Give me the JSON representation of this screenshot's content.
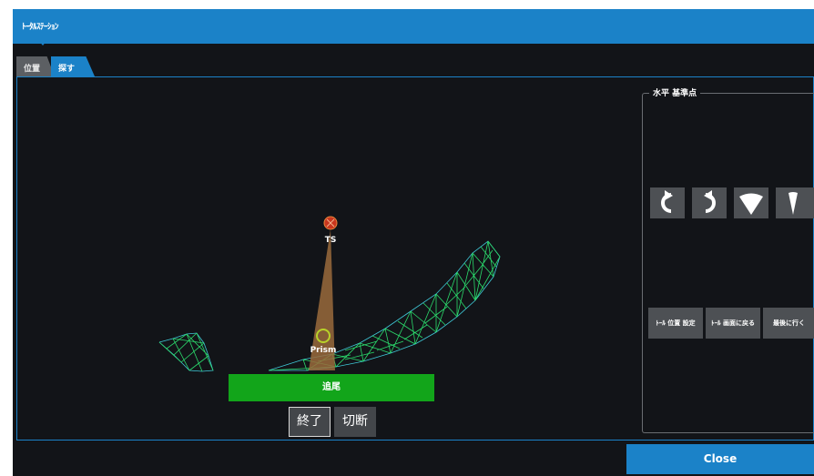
{
  "window": {
    "title": "ﾄｰﾀﾙｽﾃｰｼｮﾝ"
  },
  "tabs": [
    {
      "label": "位置",
      "active": false
    },
    {
      "label": "探す",
      "active": true
    }
  ],
  "scene": {
    "instrument_label": "TS",
    "target_label": "Prism"
  },
  "controls": {
    "track_label": "追尾",
    "end_label": "終了",
    "cut_label": "切断"
  },
  "reference": {
    "legend": "水平 基準点",
    "icons": [
      "rotate-left-icon",
      "rotate-right-icon",
      "fan-wide-icon",
      "fan-narrow-icon"
    ],
    "actions": [
      "ﾄｰﾙ 位置 設定",
      "ﾄｰﾙ 画面に戻る",
      "最後に行く"
    ]
  },
  "footer": {
    "close_label": "Close"
  },
  "colors": {
    "accent": "#1b82c8",
    "track_green": "#12a51a",
    "mesh_green": "#2bdb6c",
    "mesh_cyan": "#3fc9d8",
    "beam": "#9a6a3c",
    "instrument": "#c8361e"
  }
}
